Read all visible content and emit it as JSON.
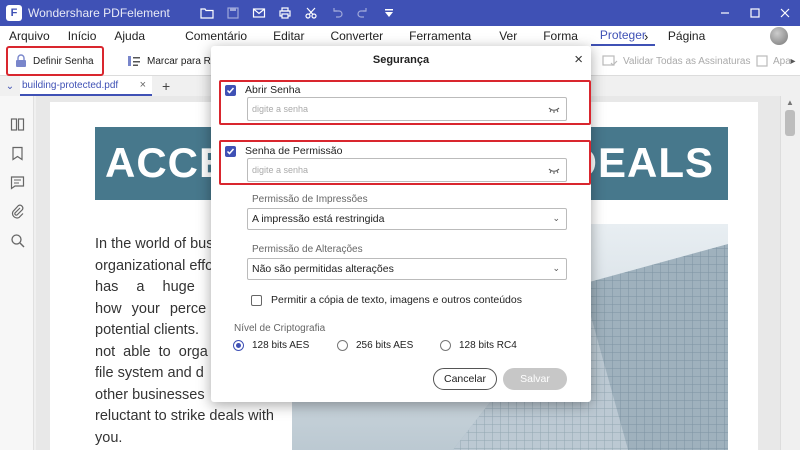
{
  "titlebar": {
    "logo": "F",
    "title": "Wondershare PDFelement",
    "quick_access": [
      "folder-icon",
      "save-icon",
      "mail-icon",
      "print-icon",
      "scissors-icon",
      "undo-icon",
      "redo-icon",
      "dropdown-icon"
    ],
    "window_controls": [
      "minimize-icon",
      "maximize-icon",
      "close-icon"
    ]
  },
  "menu": {
    "items": [
      "Arquivo",
      "Início",
      "Ajuda",
      "Comentário",
      "Editar",
      "Converter",
      "Ferramenta",
      "Ver",
      "Forma",
      "Proteger",
      "Página"
    ],
    "active": "Proteger",
    "more": "›"
  },
  "ribbon": {
    "define_password": "Definir Senha",
    "mark_for": "Marcar para Re",
    "validate_all": "Validar Todas as Assinaturas",
    "apa": "Apa"
  },
  "tabs": {
    "document": "building-protected.pdf",
    "close": "×",
    "add": "+"
  },
  "sidebar": {
    "icons": [
      "thumbnails-icon",
      "bookmark-icon",
      "comment-icon",
      "attachment-icon",
      "search-icon"
    ]
  },
  "document": {
    "banner_left": "ACCEL",
    "banner_right": "E DEALS",
    "paragraph_lines": [
      "In the world of bus",
      "organizational effo",
      "has a huge in",
      "how your perce",
      "potential clients.",
      "not able to orga",
      "file system and d",
      "other businesses",
      "reluctant to strike deals with",
      "you."
    ]
  },
  "dialog": {
    "title": "Segurança",
    "close": "×",
    "open_password": {
      "label": "Abrir Senha",
      "checked": true,
      "placeholder": "digite a senha"
    },
    "permission_password": {
      "label": "Senha de Permissão",
      "checked": true,
      "placeholder": "digite a senha"
    },
    "print_permission": {
      "label": "Permissão de Impressões",
      "value": "A impressão está restringida"
    },
    "change_permission": {
      "label": "Permissão de Alterações",
      "value": "Não são permitidas alterações"
    },
    "allow_copy": {
      "label": "Permitir a cópia de texto, imagens e outros conteúdos",
      "checked": false
    },
    "encryption": {
      "label": "Nível de Criptografia",
      "options": [
        "128 bits AES",
        "256 bits AES",
        "128 bits RC4"
      ],
      "selected": "128 bits AES"
    },
    "cancel": "Cancelar",
    "save": "Salvar"
  },
  "colors": {
    "accent": "#3f51b5",
    "highlight": "#d9262e",
    "banner": "#47788c"
  }
}
